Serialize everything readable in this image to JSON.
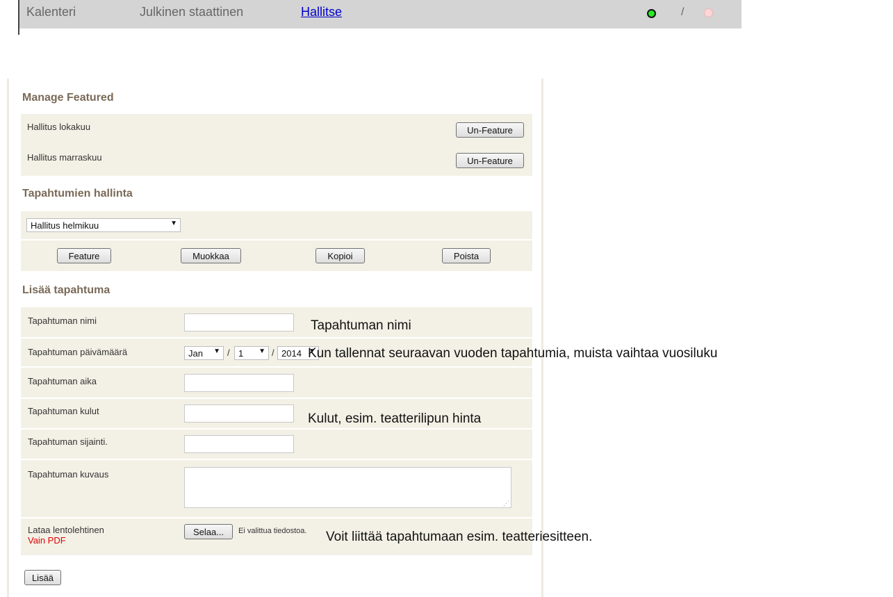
{
  "nav": {
    "items": [
      "Kalenteri",
      "Julkinen staattinen",
      "Hallitse"
    ],
    "separator": "/"
  },
  "featured": {
    "heading": "Manage Featured",
    "items": [
      {
        "label": "Hallitus lokakuu",
        "button": "Un-Feature"
      },
      {
        "label": "Hallitus marraskuu",
        "button": "Un-Feature"
      }
    ]
  },
  "manage": {
    "heading": "Tapahtumien hallinta",
    "select_value": "Hallitus helmikuu",
    "buttons": [
      "Feature",
      "Muokkaa",
      "Kopioi",
      "Poista"
    ]
  },
  "add": {
    "heading": "Lisää tapahtuma",
    "name_label": "Tapahtuman nimi",
    "date_label": "Tapahtuman päivämäärä",
    "time_label": "Tapahtuman aika",
    "cost_label": "Tapahtuman kulut",
    "location_label": "Tapahtuman sijainti.",
    "description_label": "Tapahtuman kuvaus",
    "flyer_label": "Lataa lentolehtinen",
    "flyer_sublabel": "Vain PDF",
    "browse_button": "Selaa...",
    "no_file_text": "Ei valittua tiedostoa.",
    "date": {
      "month": "Jan",
      "day": "1",
      "year": "2014",
      "separator": "/"
    },
    "submit_button": "Lisää"
  },
  "annotations": {
    "name_note": "Tapahtuman nimi",
    "date_note": "Kun tallennat seuraavan vuoden tapahtumia, muista vaihtaa vuosiluku",
    "cost_note": "Kulut, esim. teatterilipun hinta",
    "flyer_note": "Voit liittää tapahtumaan esim. teatteriesitteen."
  },
  "colors": {
    "heading": "#7a6a58",
    "box_background": "#f3f1e6",
    "pdf_note": "#e00000",
    "link": "#0000cc",
    "status_online": "#22ee22",
    "status_offline": "#fbd6d6"
  }
}
